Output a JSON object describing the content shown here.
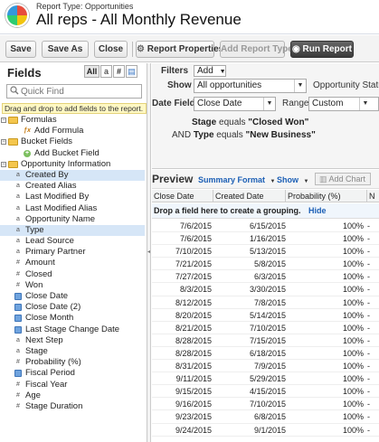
{
  "header": {
    "report_type": "Report Type: Opportunities",
    "title": "All reps - All Monthly Revenue"
  },
  "toolbar": {
    "save": "Save",
    "save_as": "Save As",
    "close": "Close",
    "report_properties": "Report Properties",
    "add_report_type": "Add Report Type",
    "run_report": "Run Report"
  },
  "sidebar": {
    "title": "Fields",
    "filter_all": "All",
    "filter_text": "a",
    "filter_number": "#",
    "filter_date": "▤",
    "quick_find_placeholder": "Quick Find",
    "drag_hint": "Drag and drop to add fields to the report.",
    "tree": [
      {
        "label": "Formulas",
        "kind": "folder",
        "indent": 0
      },
      {
        "label": "Add Formula",
        "kind": "fx",
        "indent": 2
      },
      {
        "label": "Bucket Fields",
        "kind": "folder",
        "indent": 0
      },
      {
        "label": "Add Bucket Field",
        "kind": "add",
        "indent": 2
      },
      {
        "label": "Opportunity Information",
        "kind": "folder",
        "indent": 0
      },
      {
        "label": "Created By",
        "kind": "text",
        "indent": 1,
        "selected": true
      },
      {
        "label": "Created Alias",
        "kind": "text",
        "indent": 1
      },
      {
        "label": "Last Modified By",
        "kind": "text",
        "indent": 1
      },
      {
        "label": "Last Modified Alias",
        "kind": "text",
        "indent": 1
      },
      {
        "label": "Opportunity Name",
        "kind": "text",
        "indent": 1
      },
      {
        "label": "Type",
        "kind": "text",
        "indent": 1,
        "selected": true
      },
      {
        "label": "Lead Source",
        "kind": "text",
        "indent": 1
      },
      {
        "label": "Primary Partner",
        "kind": "text",
        "indent": 1
      },
      {
        "label": "Amount",
        "kind": "number",
        "indent": 1
      },
      {
        "label": "Closed",
        "kind": "number",
        "indent": 1
      },
      {
        "label": "Won",
        "kind": "number",
        "indent": 1
      },
      {
        "label": "Close Date",
        "kind": "date",
        "indent": 1
      },
      {
        "label": "Close Date (2)",
        "kind": "date",
        "indent": 1
      },
      {
        "label": "Close Month",
        "kind": "date",
        "indent": 1
      },
      {
        "label": "Last Stage Change Date",
        "kind": "date",
        "indent": 1
      },
      {
        "label": "Next Step",
        "kind": "text",
        "indent": 1
      },
      {
        "label": "Stage",
        "kind": "text",
        "indent": 1
      },
      {
        "label": "Probability (%)",
        "kind": "number",
        "indent": 1
      },
      {
        "label": "Fiscal Period",
        "kind": "date",
        "indent": 1
      },
      {
        "label": "Fiscal Year",
        "kind": "number",
        "indent": 1
      },
      {
        "label": "Age",
        "kind": "number",
        "indent": 1
      },
      {
        "label": "Stage Duration",
        "kind": "number",
        "indent": 1
      }
    ]
  },
  "filters": {
    "filters_label": "Filters",
    "add_button": "Add",
    "show_label": "Show",
    "show_value": "All opportunities",
    "opportunity_status_label": "Opportunity Status",
    "date_field_label": "Date Field",
    "date_field_value": "Close Date",
    "range_label": "Range",
    "range_value": "Custom",
    "criteria_1_field": "Stage",
    "criteria_1_op": "equals",
    "criteria_1_value": "\"Closed Won\"",
    "criteria_2_conj": "AND",
    "criteria_2_field": "Type",
    "criteria_2_op": "equals",
    "criteria_2_value": "\"New Business\""
  },
  "preview": {
    "title": "Preview",
    "summary_format": "Summary Format",
    "show": "Show",
    "add_chart": "Add Chart",
    "columns": [
      "Close Date",
      "Created Date",
      "Probability (%)",
      "N"
    ],
    "grouping_hint": "Drop a field here to create a grouping.",
    "hide_link": "Hide",
    "rows": [
      [
        "7/6/2015",
        "6/15/2015",
        "100%",
        "-"
      ],
      [
        "7/6/2015",
        "1/16/2015",
        "100%",
        "-"
      ],
      [
        "7/10/2015",
        "5/13/2015",
        "100%",
        "-"
      ],
      [
        "7/21/2015",
        "5/8/2015",
        "100%",
        "-"
      ],
      [
        "7/27/2015",
        "6/3/2015",
        "100%",
        "-"
      ],
      [
        "8/3/2015",
        "3/30/2015",
        "100%",
        "-"
      ],
      [
        "8/12/2015",
        "7/8/2015",
        "100%",
        "-"
      ],
      [
        "8/20/2015",
        "5/14/2015",
        "100%",
        "-"
      ],
      [
        "8/21/2015",
        "7/10/2015",
        "100%",
        "-"
      ],
      [
        "8/28/2015",
        "7/15/2015",
        "100%",
        "-"
      ],
      [
        "8/28/2015",
        "6/18/2015",
        "100%",
        "-"
      ],
      [
        "8/31/2015",
        "7/9/2015",
        "100%",
        "-"
      ],
      [
        "9/11/2015",
        "5/29/2015",
        "100%",
        "-"
      ],
      [
        "9/15/2015",
        "4/15/2015",
        "100%",
        "-"
      ],
      [
        "9/16/2015",
        "7/10/2015",
        "100%",
        "-"
      ],
      [
        "9/23/2015",
        "6/8/2015",
        "100%",
        "-"
      ],
      [
        "9/24/2015",
        "9/1/2015",
        "100%",
        "-"
      ]
    ]
  }
}
